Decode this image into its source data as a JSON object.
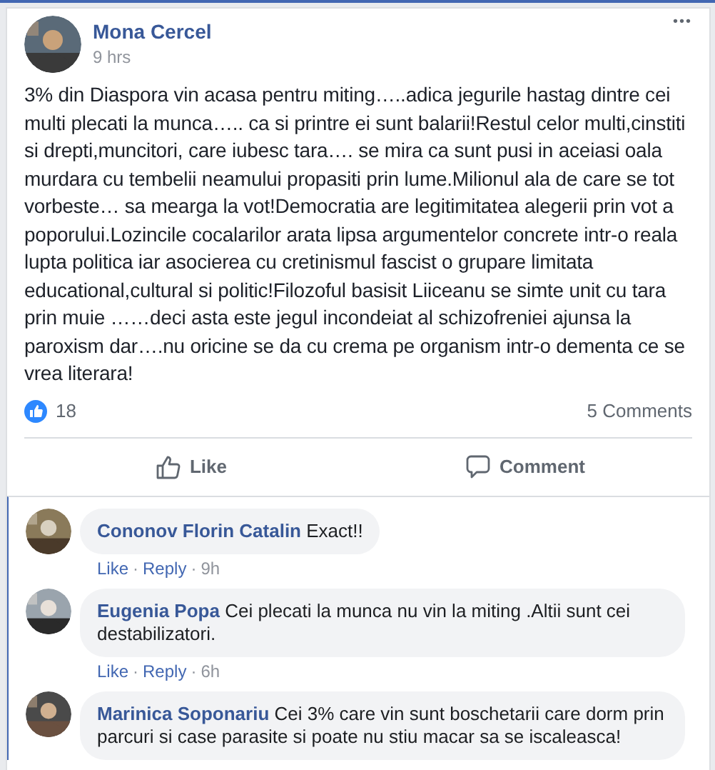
{
  "post": {
    "author": "Mona Cercel",
    "time": "9 hrs",
    "menu": "•••",
    "text": "3% din Diaspora vin acasa pentru miting…..adica jegurile hastag dintre cei multi plecati la munca….. ca si printre ei sunt balarii!Restul celor multi,cinstiti si drepti,muncitori, care iubesc tara…. se mira ca sunt pusi in aceiasi oala murdara cu tembelii neamului propasiti prin lume.Milionul ala de care se tot vorbeste… sa mearga la vot!Democratia are legitimitatea alegerii prin vot a poporului.Lozincile cocalarilor arata lipsa argumentelor concrete intr-o reala lupta politica iar asocierea cu cretinismul fascist o grupare limitata educational,cultural si politic!Filozoful basisit Liiceanu se simte unit cu tara prin muie ……deci asta este jegul incondeiat al schizofreniei ajunsa la paroxism dar….nu oricine se da cu crema pe organism intr-o dementa ce se vrea literara!",
    "reactions": "18",
    "comments_count": "5 Comments",
    "actions": [
      {
        "kind": "like",
        "label": "Like"
      },
      {
        "kind": "comment",
        "label": "Comment"
      }
    ]
  },
  "comments": [
    {
      "author": "Cononov Florin Catalin",
      "text": "Exact!!",
      "like": "Like",
      "sep": "·",
      "reply": "Reply",
      "sep2": "·",
      "time": "9h"
    },
    {
      "author": "Eugenia Popa",
      "text": "Cei plecati la munca nu vin la miting .Altii sunt cei destabilizatori.",
      "like": "Like",
      "sep": "·",
      "reply": "Reply",
      "sep2": "·",
      "time": "6h"
    },
    {
      "author": "Marinica Soponariu",
      "text": "Cei 3% care vin sunt boschetarii care dorm prin parcuri si case parasite si poate nu stiu macar sa se iscaleasca!"
    }
  ]
}
